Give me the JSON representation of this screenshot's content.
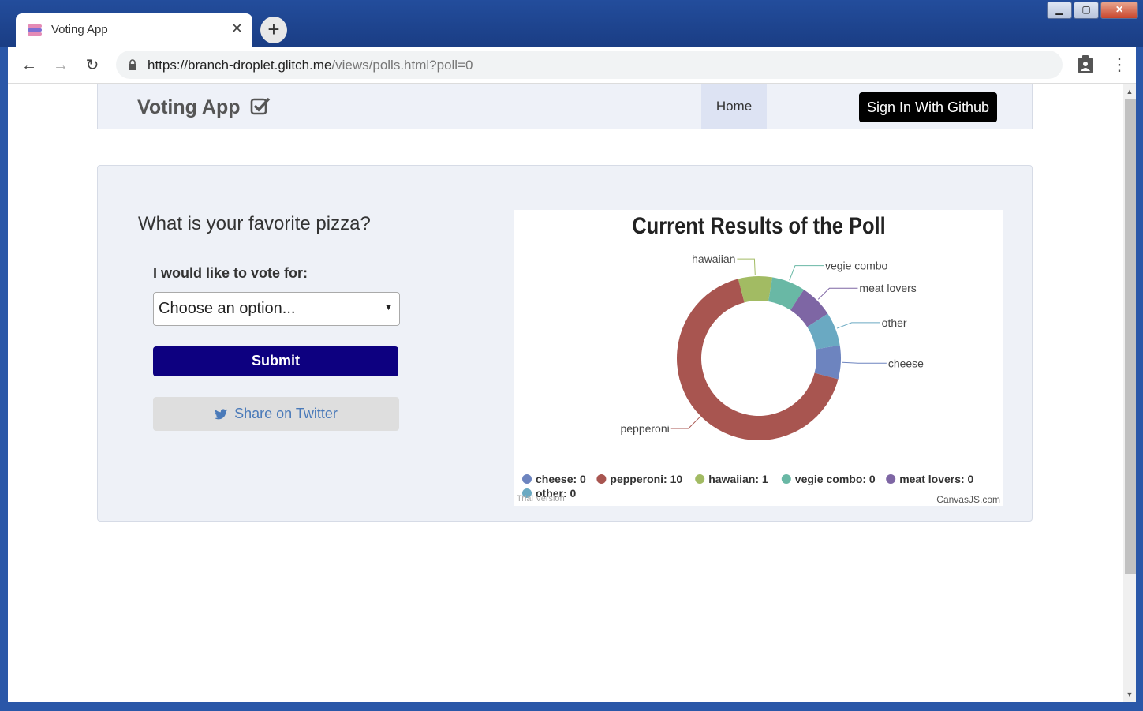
{
  "browser": {
    "tab_title": "Voting App",
    "tab_close": "✕",
    "new_tab": "+",
    "url_host": "https://branch-droplet.glitch.me",
    "url_path": "/views/polls.html?poll=0",
    "window_buttons": {
      "minimize": "▁",
      "maximize": "▢",
      "close": "✕"
    }
  },
  "navbar": {
    "brand": "Voting App",
    "home": "Home",
    "signin": "Sign In With Github"
  },
  "poll": {
    "question": "What is your favorite pizza?",
    "vote_label": "I would like to vote for:",
    "select_value": "Choose an option...",
    "submit": "Submit",
    "share": "Share on Twitter"
  },
  "chart_data": {
    "type": "pie",
    "subtype": "doughnut",
    "title": "Current Results of the Poll",
    "categories": [
      "cheese",
      "pepperoni",
      "hawaiian",
      "vegie combo",
      "meat lovers",
      "other"
    ],
    "values": [
      0,
      10,
      1,
      0,
      0,
      0
    ],
    "legend": [
      {
        "label": "cheese: 0",
        "color": "#6d84bf"
      },
      {
        "label": "pepperoni: 10",
        "color": "#a85550"
      },
      {
        "label": "hawaiian: 1",
        "color": "#a2bb63"
      },
      {
        "label": "vegie combo: 0",
        "color": "#69b8a5"
      },
      {
        "label": "meat lovers: 0",
        "color": "#7e66a4"
      },
      {
        "label": "other: 0",
        "color": "#6aa9c2"
      }
    ],
    "legend_position": "bottom",
    "credit": "CanvasJS.com",
    "watermark": "Trial Version"
  }
}
